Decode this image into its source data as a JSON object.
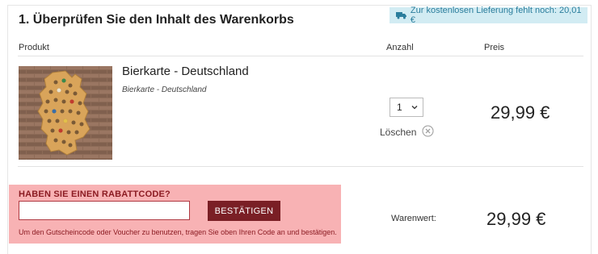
{
  "cart": {
    "title": "1. Überprüfen Sie den Inhalt des Warenkorbs",
    "shipping_notice": "Zur kostenlosen Lieferung fehlt noch: 20,01 €",
    "shipping_icon": "truck-icon",
    "columns": {
      "product": "Produkt",
      "quantity": "Anzahl",
      "price": "Preis"
    },
    "items": [
      {
        "name": "Bierkarte - Deutschland",
        "subtitle": "Bierkarte - Deutschland",
        "quantity": "1",
        "delete_label": "Löschen",
        "price": "29,99 €"
      }
    ]
  },
  "coupon": {
    "title": "HABEN SIE EINEN RABATTCODE?",
    "input_value": "",
    "button_label": "BESTÄTIGEN",
    "help_text": "Um den Gutscheincode oder Voucher zu benutzen, tragen Sie oben Ihren Code an und bestätigen."
  },
  "summary": {
    "label": "Warenwert:",
    "value": "29,99 €"
  },
  "colors": {
    "shipping_badge_bg": "#d2ecf3",
    "shipping_badge_text": "#2a7d9c",
    "coupon_bg": "#f8b2b4",
    "coupon_text": "#8b1b22",
    "button_bg": "#7a1f25"
  }
}
